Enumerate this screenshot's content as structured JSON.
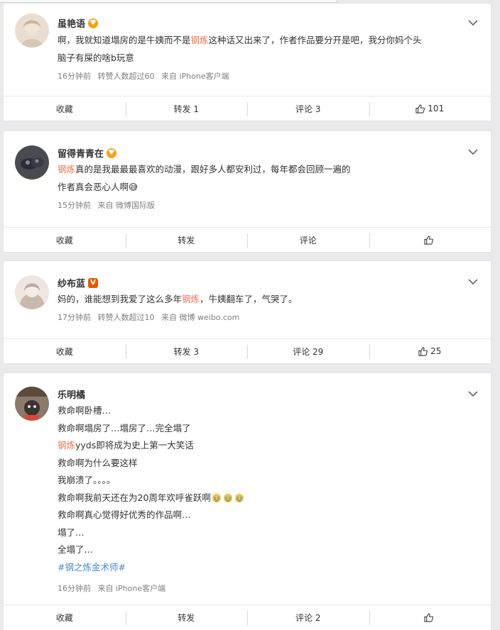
{
  "posts": [
    {
      "username": "虽艳语",
      "badge": "heart",
      "content_html": [
        "啊，我就知道塌房的是牛姨而不是<span class=\"hl\">钢炼</span>这种话又出来了，作者作品要分开是吧，我分你妈个头",
        "脑子有屎的啥b玩意"
      ],
      "meta": [
        "16分钟前",
        "转赞人数超过60",
        "来自 iPhone客户端"
      ],
      "actions": {
        "collect": "收藏",
        "repost": "转发 1",
        "comment": "评论 3",
        "like": "101"
      }
    },
    {
      "username": "留得青青在",
      "badge": "heart",
      "content_html": [
        "<span class=\"hl\">钢炼</span>真的是我最最最喜欢的动漫，跟好多人都安利过，每年都会回顾一遍的",
        "作者真会恶心人啊😅"
      ],
      "meta": [
        "15分钟前",
        "来自 微博国际版"
      ],
      "actions": {
        "collect": "收藏",
        "repost": "转发",
        "comment": "评论",
        "like": ""
      }
    },
    {
      "username": "纱布蓝",
      "badge": "vip",
      "content_html": [
        "妈的，谁能想到我爱了这么多年<span class=\"hl\">钢炼</span>，牛姨翻车了，气哭了。"
      ],
      "meta": [
        "17分钟前",
        "转赞人数超过10",
        "来自 微博 weibo.com"
      ],
      "actions": {
        "collect": "收藏",
        "repost": "转发 3",
        "comment": "评论 29",
        "like": "25"
      }
    },
    {
      "username": "乐明橘",
      "badge": "",
      "content_html": [
        "救命啊卧槽…",
        "救命啊塌房了…塌房了…完全塌了",
        "<span class=\"hl\">钢炼</span>yyds即将成为史上第一大笑话",
        "救命啊为什么要这样",
        "我崩溃了。。。。",
        "救命啊我前天还在为20周年欢呼雀跃啊",
        "救命啊真心觉得好优秀的作品啊…",
        "塌了…",
        "全塌了…",
        "<span class=\"topic\">#钢之炼金术师#</span>"
      ],
      "meta": [
        "16分钟前",
        "来自 iPhone客户端"
      ],
      "actions": {
        "collect": "收藏",
        "repost": "转发",
        "comment": "评论 2",
        "like": ""
      }
    }
  ],
  "icons": {
    "chevron": "chevron-down-icon",
    "like": "thumbs-up-icon",
    "badge_heart": "heart-eyes-badge-icon",
    "badge_vip": "vip-badge-icon",
    "cry_emoji": "crying-emoji-icon"
  },
  "colors": {
    "highlight": "#eb7350",
    "topic": "#4b88c9",
    "meta": "#808080",
    "text": "#333333"
  }
}
